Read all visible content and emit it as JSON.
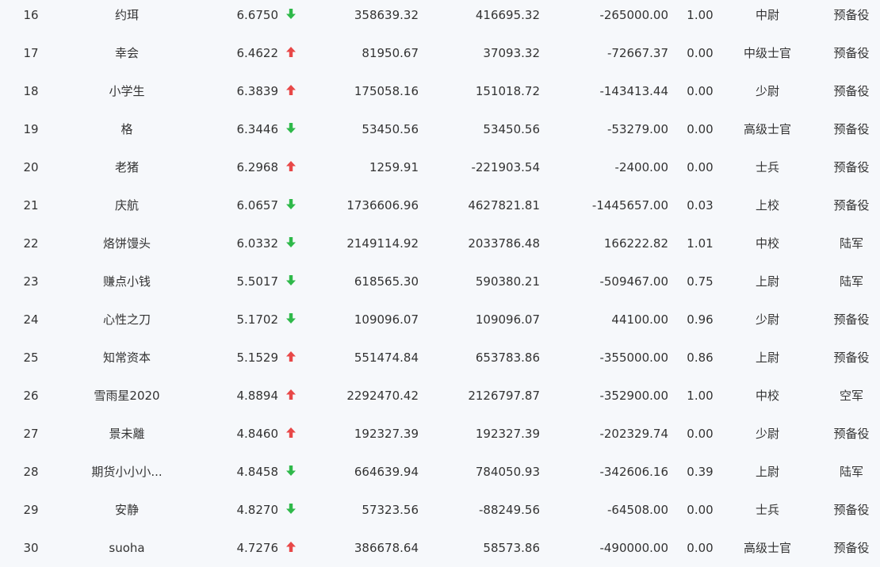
{
  "colors": {
    "up": "#e84848",
    "down": "#2fb94a",
    "text": "#333333",
    "background": "#f6f8fb"
  },
  "rows": [
    {
      "rank": "16",
      "name": "约珥",
      "score": "6.6750",
      "trend": "down",
      "value1": "358639.32",
      "value2": "416695.32",
      "value3": "-265000.00",
      "ratio": "1.00",
      "title": "中尉",
      "branch": "预备役"
    },
    {
      "rank": "17",
      "name": "幸会",
      "score": "6.4622",
      "trend": "up",
      "value1": "81950.67",
      "value2": "37093.32",
      "value3": "-72667.37",
      "ratio": "0.00",
      "title": "中级士官",
      "branch": "预备役"
    },
    {
      "rank": "18",
      "name": "小学生",
      "score": "6.3839",
      "trend": "up",
      "value1": "175058.16",
      "value2": "151018.72",
      "value3": "-143413.44",
      "ratio": "0.00",
      "title": "少尉",
      "branch": "预备役"
    },
    {
      "rank": "19",
      "name": "格",
      "score": "6.3446",
      "trend": "down",
      "value1": "53450.56",
      "value2": "53450.56",
      "value3": "-53279.00",
      "ratio": "0.00",
      "title": "高级士官",
      "branch": "预备役"
    },
    {
      "rank": "20",
      "name": "老猪",
      "score": "6.2968",
      "trend": "up",
      "value1": "1259.91",
      "value2": "-221903.54",
      "value3": "-2400.00",
      "ratio": "0.00",
      "title": "士兵",
      "branch": "预备役"
    },
    {
      "rank": "21",
      "name": "庆航",
      "score": "6.0657",
      "trend": "down",
      "value1": "1736606.96",
      "value2": "4627821.81",
      "value3": "-1445657.00",
      "ratio": "0.03",
      "title": "上校",
      "branch": "预备役"
    },
    {
      "rank": "22",
      "name": "烙饼馒头",
      "score": "6.0332",
      "trend": "down",
      "value1": "2149114.92",
      "value2": "2033786.48",
      "value3": "166222.82",
      "ratio": "1.01",
      "title": "中校",
      "branch": "陆军"
    },
    {
      "rank": "23",
      "name": "赚点小钱",
      "score": "5.5017",
      "trend": "down",
      "value1": "618565.30",
      "value2": "590380.21",
      "value3": "-509467.00",
      "ratio": "0.75",
      "title": "上尉",
      "branch": "陆军"
    },
    {
      "rank": "24",
      "name": "心性之刀",
      "score": "5.1702",
      "trend": "down",
      "value1": "109096.07",
      "value2": "109096.07",
      "value3": "44100.00",
      "ratio": "0.96",
      "title": "少尉",
      "branch": "预备役"
    },
    {
      "rank": "25",
      "name": "知常资本",
      "score": "5.1529",
      "trend": "up",
      "value1": "551474.84",
      "value2": "653783.86",
      "value3": "-355000.00",
      "ratio": "0.86",
      "title": "上尉",
      "branch": "预备役"
    },
    {
      "rank": "26",
      "name": "雪雨星2020",
      "score": "4.8894",
      "trend": "up",
      "value1": "2292470.42",
      "value2": "2126797.87",
      "value3": "-352900.00",
      "ratio": "1.00",
      "title": "中校",
      "branch": "空军"
    },
    {
      "rank": "27",
      "name": "景未離",
      "score": "4.8460",
      "trend": "up",
      "value1": "192327.39",
      "value2": "192327.39",
      "value3": "-202329.74",
      "ratio": "0.00",
      "title": "少尉",
      "branch": "预备役"
    },
    {
      "rank": "28",
      "name": "期货小小小...",
      "score": "4.8458",
      "trend": "down",
      "value1": "664639.94",
      "value2": "784050.93",
      "value3": "-342606.16",
      "ratio": "0.39",
      "title": "上尉",
      "branch": "陆军"
    },
    {
      "rank": "29",
      "name": "安静",
      "score": "4.8270",
      "trend": "down",
      "value1": "57323.56",
      "value2": "-88249.56",
      "value3": "-64508.00",
      "ratio": "0.00",
      "title": "士兵",
      "branch": "预备役"
    },
    {
      "rank": "30",
      "name": "suoha",
      "score": "4.7276",
      "trend": "up",
      "value1": "386678.64",
      "value2": "58573.86",
      "value3": "-490000.00",
      "ratio": "0.00",
      "title": "高级士官",
      "branch": "预备役"
    }
  ]
}
